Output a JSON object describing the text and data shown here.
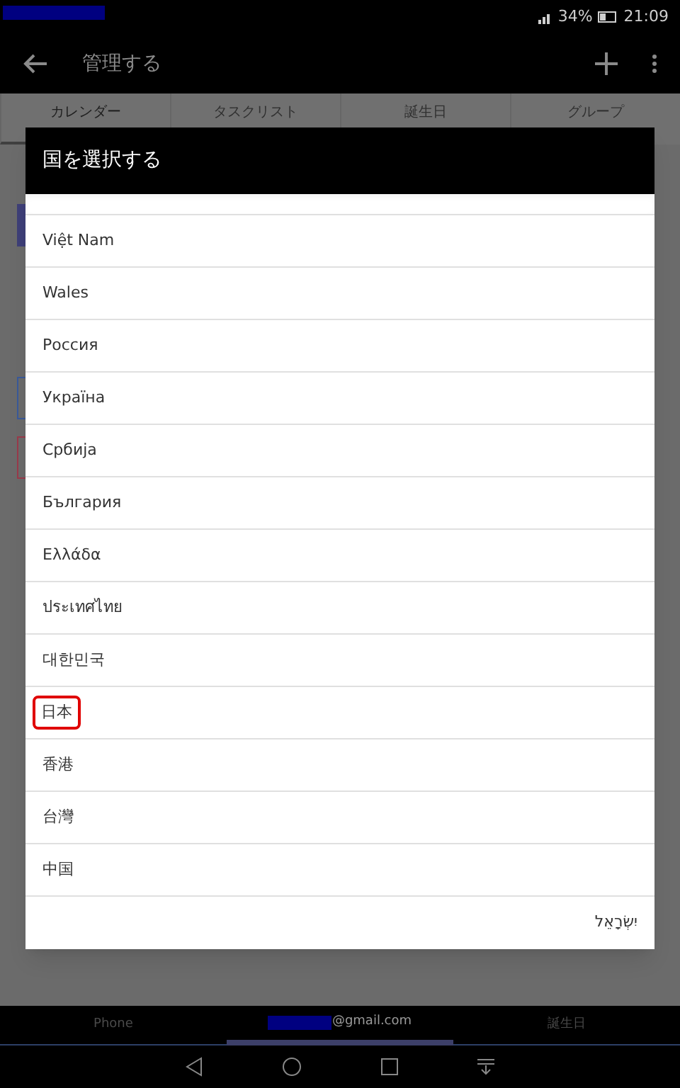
{
  "status_bar": {
    "battery": "34%",
    "time": "21:09"
  },
  "app_bar": {
    "title": "管理する"
  },
  "tabs": [
    {
      "label": "カレンダー",
      "selected": true
    },
    {
      "label": "タスクリスト",
      "selected": false
    },
    {
      "label": "誕生日",
      "selected": false
    },
    {
      "label": "グループ",
      "selected": false
    }
  ],
  "dialog": {
    "title": "国を選択する",
    "items": [
      {
        "label": "Việt Nam",
        "highlighted": false
      },
      {
        "label": "Wales",
        "highlighted": false
      },
      {
        "label": "Россия",
        "highlighted": false
      },
      {
        "label": "Україна",
        "highlighted": false
      },
      {
        "label": "Србија",
        "highlighted": false
      },
      {
        "label": "България",
        "highlighted": false
      },
      {
        "label": "Ελλάδα",
        "highlighted": false
      },
      {
        "label": "ประเทศไทย",
        "highlighted": false
      },
      {
        "label": "대한민국",
        "highlighted": false
      },
      {
        "label": "日本",
        "highlighted": true
      },
      {
        "label": "香港",
        "highlighted": false
      },
      {
        "label": "台灣",
        "highlighted": false
      },
      {
        "label": "中国",
        "highlighted": false
      },
      {
        "label": "יִשְׂרָאֵל",
        "highlighted": false
      }
    ]
  },
  "bottom_tabs": [
    {
      "label": "Phone",
      "selected": false,
      "redacted": false
    },
    {
      "label": "@gmail.com",
      "selected": true,
      "redacted": true
    },
    {
      "label": "誕生日",
      "selected": false,
      "redacted": false
    }
  ]
}
